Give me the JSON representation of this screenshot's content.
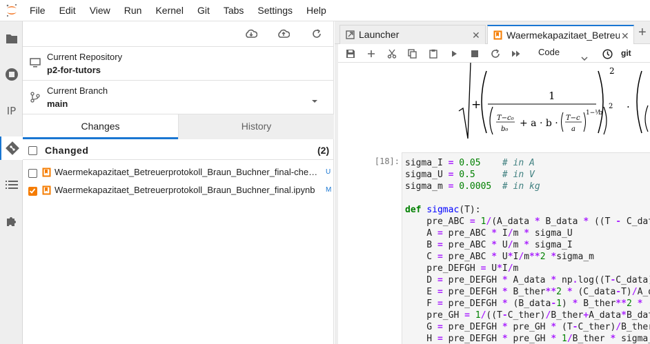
{
  "menubar": {
    "items": [
      "File",
      "Edit",
      "View",
      "Run",
      "Kernel",
      "Git",
      "Tabs",
      "Settings",
      "Help"
    ]
  },
  "sidebar": {
    "text_icon": "IP",
    "icons": [
      "folder-icon",
      "running-icon",
      "property-inspector-icon",
      "git-icon",
      "toc-icon",
      "extension-icon"
    ]
  },
  "git_panel": {
    "current_repository_label": "Current Repository",
    "current_repository": "p2-for-tutors",
    "current_branch_label": "Current Branch",
    "current_branch": "main",
    "tabs": [
      "Changes",
      "History"
    ],
    "changed_label": "Changed",
    "changed_count": "(2)",
    "files": [
      {
        "name": "Waermekapazitaet_Betreuerprotokoll_Braun_Buchner_final-checkpoint.ipynb",
        "status": "U",
        "checked": false
      },
      {
        "name": "Waermekapazitaet_Betreuerprotokoll_Braun_Buchner_final.ipynb",
        "status": "M",
        "checked": true
      }
    ]
  },
  "main": {
    "tabs": [
      {
        "label": "Launcher"
      },
      {
        "label": "Waermekapazitaet_Betreuerprotokoll_Braun_Buchner_final.ipynb"
      }
    ],
    "toolbar": {
      "cell_type": "Code",
      "git_label": "git"
    },
    "cell": {
      "prompt": "[18]:"
    }
  },
  "colors": {
    "accent": "#1976d2",
    "git_orange": "#f57c00",
    "jupyter_orange": "#f37726"
  }
}
